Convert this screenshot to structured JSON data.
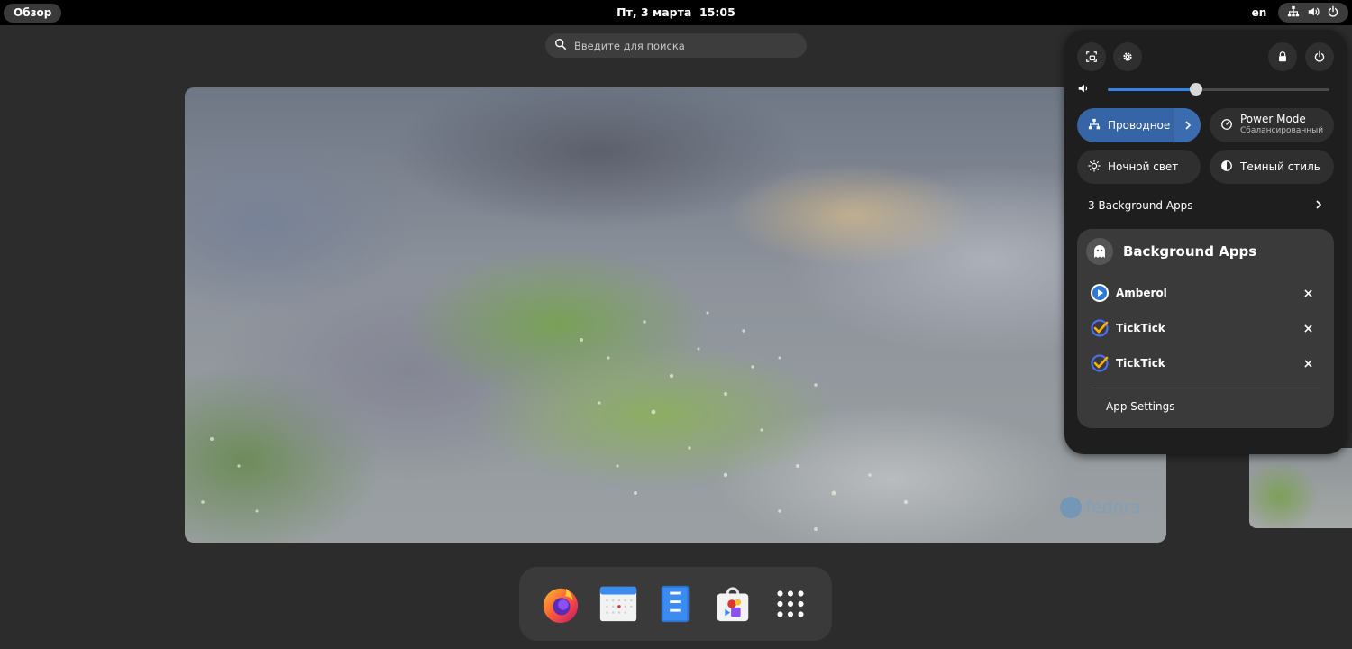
{
  "topbar": {
    "activities": "Обзор",
    "date": "Пт, 3 марта",
    "time": "15:05",
    "language": "en",
    "indicators": [
      "network-wired-icon",
      "volume-icon",
      "power-icon"
    ]
  },
  "search": {
    "placeholder": "Введите для поиска"
  },
  "workspace": {
    "wallpaper_brand": "fedora"
  },
  "dash": {
    "apps": [
      "firefox",
      "calendar",
      "files",
      "software",
      "show-apps"
    ]
  },
  "quick_settings": {
    "volume_percent": 40,
    "tiles": {
      "network": {
        "label": "Проводное",
        "active": true
      },
      "power_mode": {
        "label": "Power Mode",
        "sub": "Сбалансированный"
      },
      "night_light": {
        "label": "Ночной свет"
      },
      "dark_style": {
        "label": "Темный стиль"
      }
    },
    "background_apps_row": "3 Background Apps",
    "background_apps": {
      "title": "Background Apps",
      "apps": [
        {
          "name": "Amberol"
        },
        {
          "name": "TickTick"
        },
        {
          "name": "TickTick"
        }
      ],
      "settings_label": "App Settings"
    }
  },
  "colors": {
    "accent": "#3584e4",
    "active_tile": "#3565a6",
    "panel": "#1e1e1e"
  }
}
